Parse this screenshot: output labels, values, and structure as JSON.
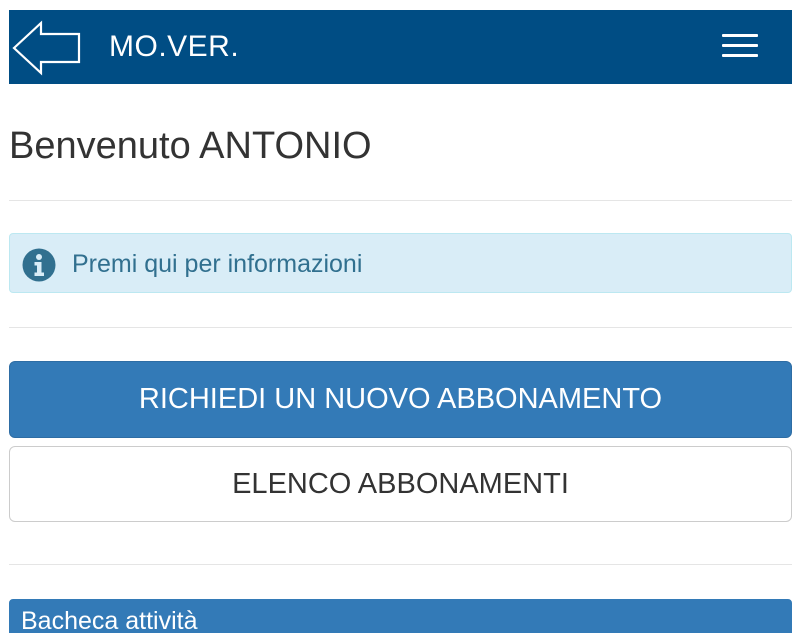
{
  "header": {
    "title": "MO.VER.",
    "back_icon": "back-arrow-icon",
    "menu_icon": "hamburger-menu-icon"
  },
  "main": {
    "welcome": "Benvenuto ANTONIO",
    "info_alert": {
      "icon": "info-circle-icon",
      "text": "Premi qui per informazioni"
    },
    "primary_button_label": "RICHIEDI UN NUOVO ABBONAMENTO",
    "secondary_button_label": "ELENCO ABBONAMENTI",
    "panel_heading": "Bacheca attività"
  },
  "colors": {
    "navbar": "#004d84",
    "primary": "#337ab7",
    "info_background": "#d9edf7",
    "info_text": "#31708f"
  }
}
